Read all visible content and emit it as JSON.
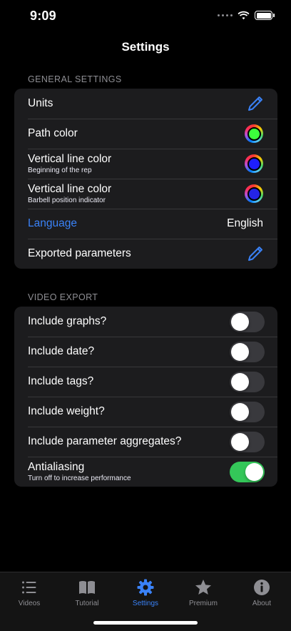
{
  "status": {
    "time": "9:09"
  },
  "nav": {
    "title": "Settings"
  },
  "general": {
    "header": "GENERAL SETTINGS",
    "rows": [
      {
        "label": "Units",
        "sub": "",
        "accessory": "pencil-icon"
      },
      {
        "label": "Path color",
        "sub": "",
        "color": "#3cff3c"
      },
      {
        "label": "Vertical line color",
        "sub": "Beginning of the rep",
        "color": "#1e1eff"
      },
      {
        "label": "Vertical line color",
        "sub": "Barbell position indicator",
        "color": "#2424e6"
      },
      {
        "label": "Language",
        "sub": "",
        "value": "English"
      },
      {
        "label": "Exported parameters",
        "sub": "",
        "accessory": "pencil-icon"
      }
    ]
  },
  "video_export": {
    "header": "VIDEO EXPORT",
    "rows": [
      {
        "label": "Include graphs?",
        "sub": "",
        "on": false
      },
      {
        "label": "Include date?",
        "sub": "",
        "on": false
      },
      {
        "label": "Include tags?",
        "sub": "",
        "on": false
      },
      {
        "label": "Include weight?",
        "sub": "",
        "on": false
      },
      {
        "label": "Include parameter aggregates?",
        "sub": "",
        "on": false
      },
      {
        "label": "Antialiasing",
        "sub": "Turn off to increase performance",
        "on": true
      }
    ]
  },
  "tabs": [
    {
      "label": "Videos",
      "icon": "list-icon",
      "active": false
    },
    {
      "label": "Tutorial",
      "icon": "book-icon",
      "active": false
    },
    {
      "label": "Settings",
      "icon": "gear-icon",
      "active": true
    },
    {
      "label": "Premium",
      "icon": "star-icon",
      "active": false
    },
    {
      "label": "About",
      "icon": "info-icon",
      "active": false
    }
  ],
  "colors": {
    "accent": "#3a82f7",
    "toggle_on": "#34c759",
    "toggle_off": "#39393d",
    "inactive_tab": "#8e8e93"
  }
}
